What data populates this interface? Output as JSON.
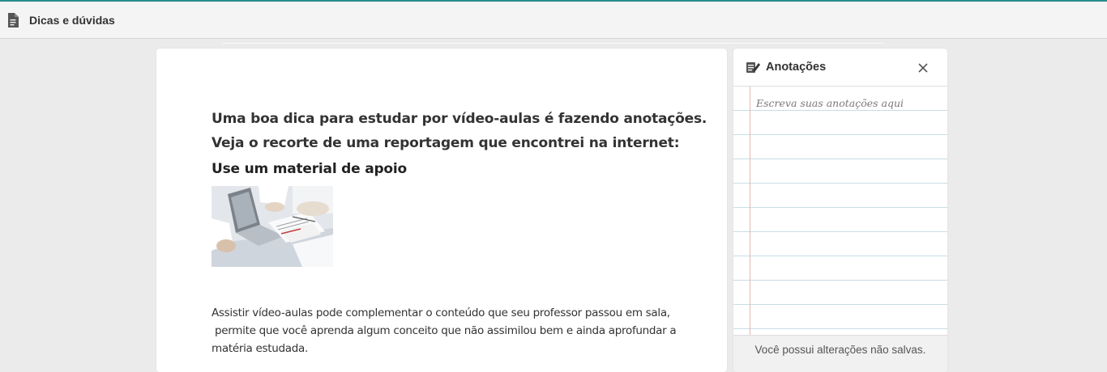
{
  "header": {
    "title": "Dicas e dúvidas",
    "icon": "document-icon"
  },
  "article": {
    "headline_1": "Uma boa dica para estudar por vídeo-aulas é fazendo anotações.",
    "headline_2": "Veja o recorte de uma reportagem que encontrei na internet:",
    "subheading": "Use um material de apoio",
    "image": "laptop-documents-photo",
    "paragraph_line_1": "Assistir vídeo-aulas pode complementar o conteúdo que seu professor passou em sala,",
    "paragraph_line_2": " permite que você aprenda algum conceito que não assimilou bem e ainda aprofundar a",
    "paragraph_line_3": "matéria estudada."
  },
  "notes_panel": {
    "title": "Anotações",
    "icon": "pencil-notepad-icon",
    "close_icon": "close-icon",
    "placeholder": "Escreva suas anotações aqui",
    "footer_status": "Você possui alterações não salvas."
  },
  "colors": {
    "accent_top_border": "#2a8c8c",
    "background": "#ebebeb",
    "notes_line": "#c8dde6",
    "notes_margin": "#e6b6b6"
  }
}
